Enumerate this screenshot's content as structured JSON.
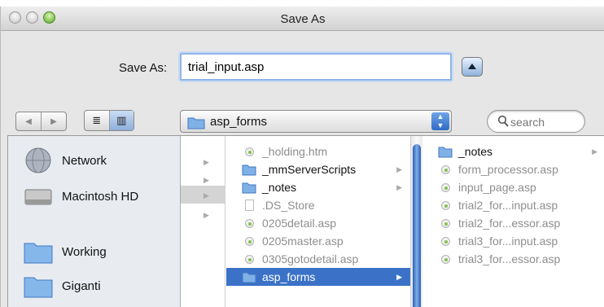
{
  "window": {
    "title": "Save As"
  },
  "save": {
    "label": "Save As:",
    "filename": "trial_input.asp"
  },
  "toolbar": {
    "back_glyph": "◀",
    "forward_glyph": "▶",
    "list_view_glyph": "≣",
    "column_view_glyph": "▥",
    "current_folder": "asp_forms",
    "search_placeholder": "search"
  },
  "sidebar": {
    "items": [
      {
        "label": "Network",
        "icon": "network-icon"
      },
      {
        "label": "Macintosh HD",
        "icon": "hard-drive-icon"
      },
      {
        "label": "Working",
        "icon": "folder-icon"
      },
      {
        "label": "Giganti",
        "icon": "folder-icon"
      }
    ]
  },
  "column2": {
    "items": [
      {
        "name": "_holding.htm",
        "kind": "file",
        "dim": true
      },
      {
        "name": "_mmServerScripts",
        "kind": "folder",
        "dim": false,
        "arrow": true
      },
      {
        "name": "_notes",
        "kind": "folder",
        "dim": false,
        "arrow": true
      },
      {
        "name": ".DS_Store",
        "kind": "doc",
        "dim": true
      },
      {
        "name": "0205detail.asp",
        "kind": "file",
        "dim": true
      },
      {
        "name": "0205master.asp",
        "kind": "file",
        "dim": true
      },
      {
        "name": "0305gotodetail.asp",
        "kind": "file",
        "dim": true
      },
      {
        "name": "asp_forms",
        "kind": "folder",
        "dim": false,
        "arrow": true,
        "selected": true
      }
    ]
  },
  "column3": {
    "items": [
      {
        "name": "_notes",
        "kind": "folder",
        "dim": false,
        "arrow": true
      },
      {
        "name": "form_processor.asp",
        "kind": "file",
        "dim": true
      },
      {
        "name": "input_page.asp",
        "kind": "file",
        "dim": true
      },
      {
        "name": "trial2_for...input.asp",
        "kind": "file",
        "dim": true
      },
      {
        "name": "trial2_for...essor.asp",
        "kind": "file",
        "dim": true
      },
      {
        "name": "trial3_for...input.asp",
        "kind": "file",
        "dim": true
      },
      {
        "name": "trial3_for...essor.asp",
        "kind": "file",
        "dim": true
      }
    ]
  },
  "colors": {
    "selection": "#3b72c8",
    "sidebar_bg": "#e8ecf1",
    "window_bg": "#e6e6e6"
  }
}
